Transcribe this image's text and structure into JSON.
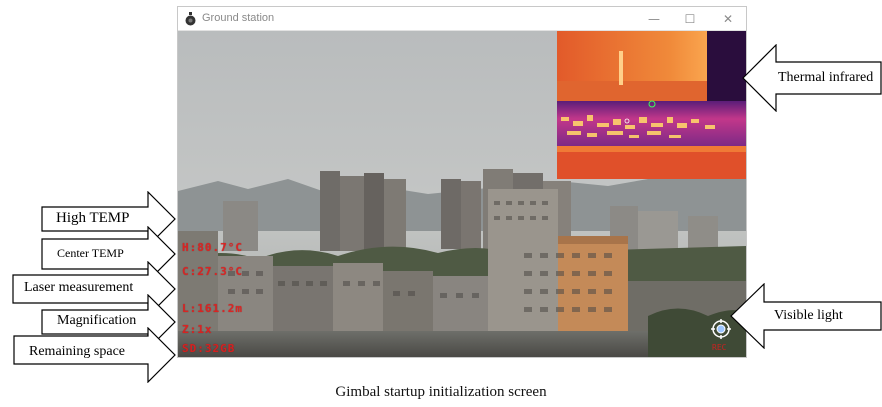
{
  "window": {
    "title": "Ground station",
    "minimize_glyph": "—",
    "maximize_glyph": "☐",
    "close_glyph": "✕",
    "icon": "gimbal-icon"
  },
  "osd": {
    "high_temp": "H:80.7°C",
    "center_temp": "C:27.3°C",
    "laser": "L:161.2m",
    "zoom": "Z:1x",
    "remaining": "SD:32GB"
  },
  "status_corner": "REC",
  "callouts": {
    "high_temp": "High TEMP",
    "center_temp": "Center TEMP",
    "laser": "Laser measurement",
    "magnification": "Magnification",
    "remaining_space": "Remaining space",
    "thermal": "Thermal infrared",
    "visible": "Visible light"
  },
  "caption": "Gimbal startup initialization screen",
  "colors": {
    "osd_text": "#e31b1b",
    "thermal_hot": "#ffb347",
    "thermal_mid": "#e8542a",
    "thermal_cold": "#4a1a6b"
  }
}
